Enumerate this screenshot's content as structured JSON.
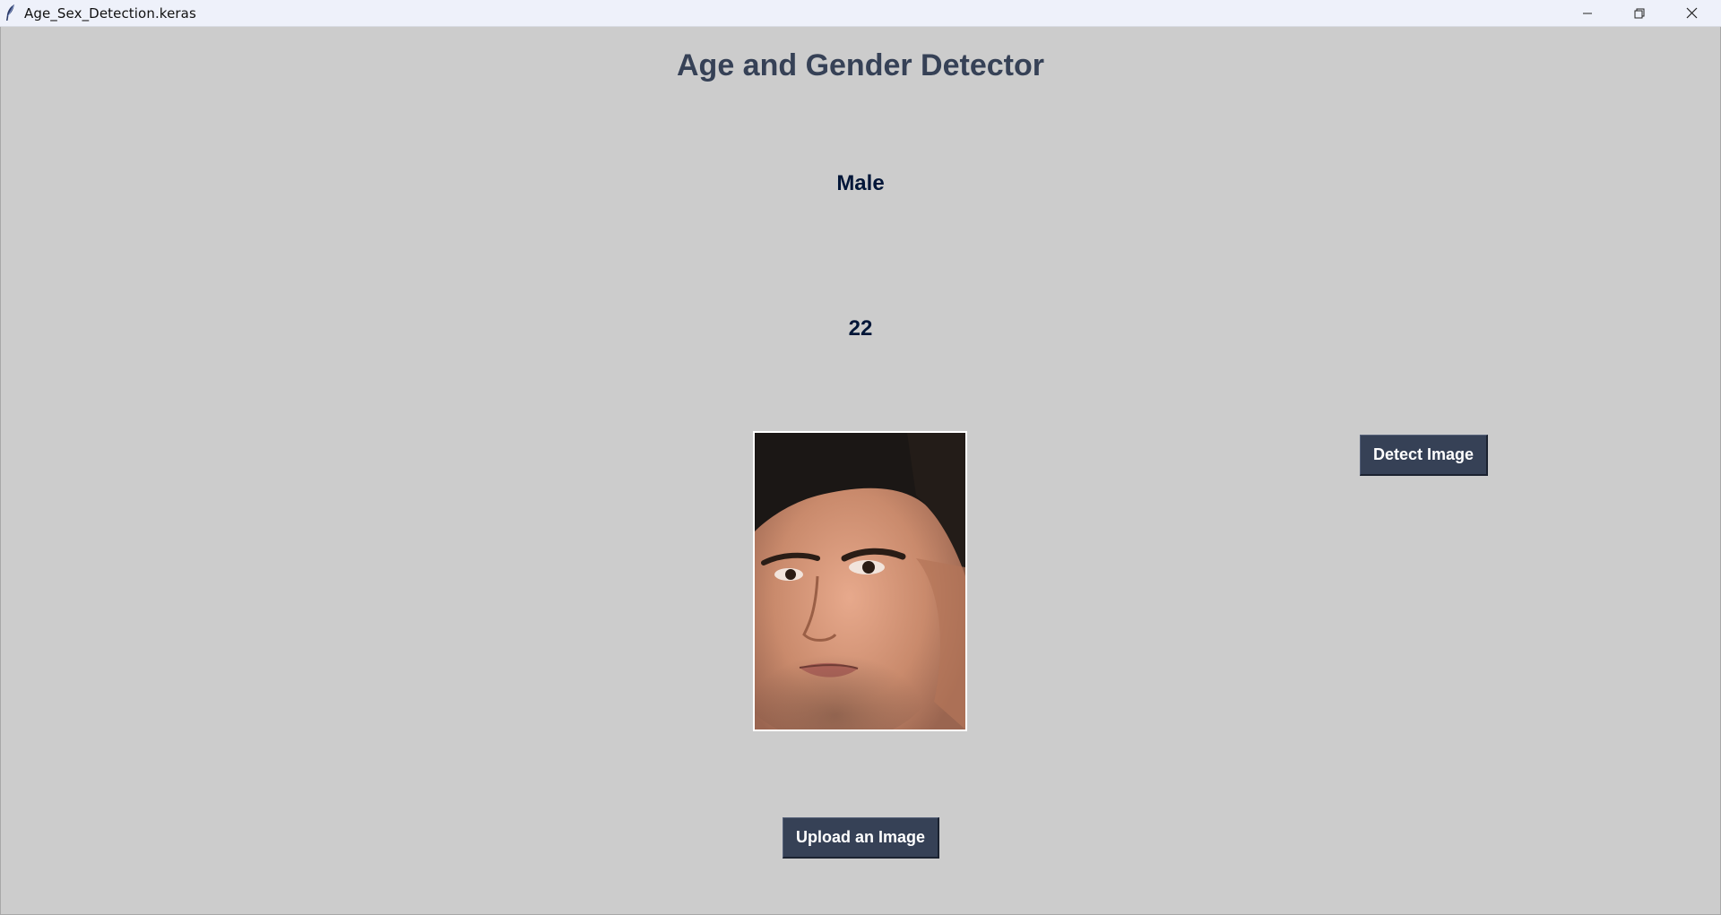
{
  "window": {
    "title": "Age_Sex_Detection.keras",
    "icon": "feather-icon",
    "controls": [
      "minimize-icon",
      "restore-icon",
      "close-icon"
    ]
  },
  "main": {
    "heading": "Age and Gender Detector",
    "gender_result": "Male",
    "age_result": "22",
    "detect_button_label": "Detect Image",
    "upload_button_label": "Upload an Image"
  },
  "colors": {
    "background": "#cccccc",
    "heading": "#364156",
    "result_text": "#011638",
    "button_bg": "#364156",
    "button_text": "#ffffff"
  }
}
